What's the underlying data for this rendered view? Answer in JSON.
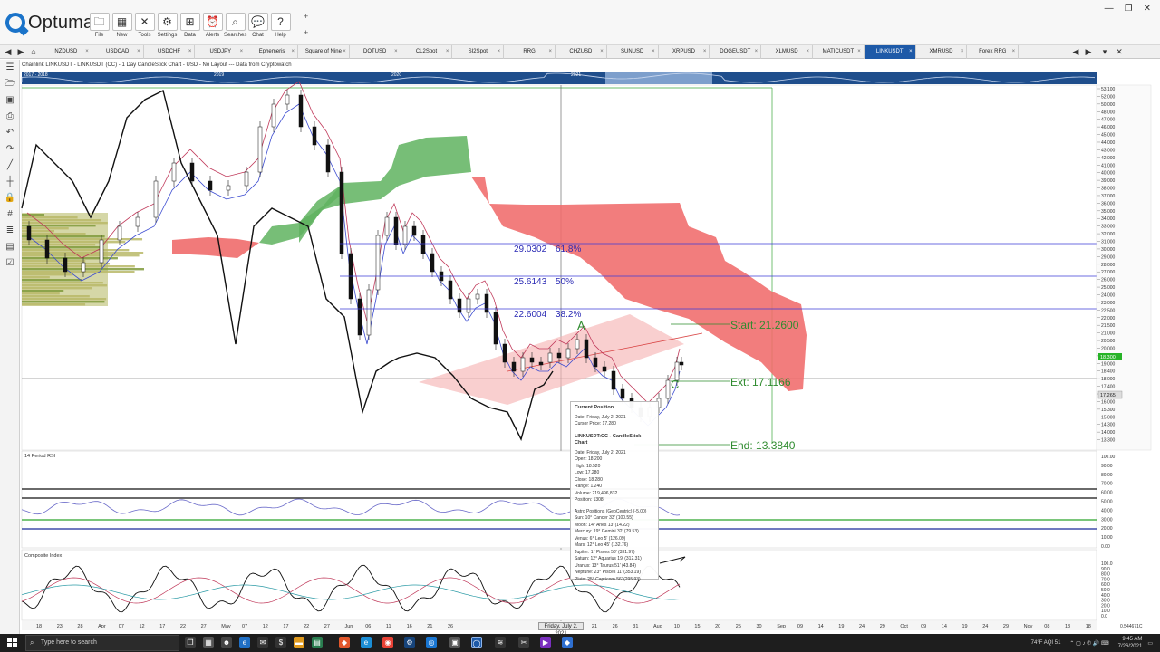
{
  "app": {
    "brand": "Optuma",
    "toolbar": [
      {
        "label": "File",
        "icon": "folder-icon",
        "glyph": "🗀"
      },
      {
        "label": "New",
        "icon": "new-chart-icon",
        "glyph": "▦"
      },
      {
        "label": "Tools",
        "icon": "tools-icon",
        "glyph": "✕"
      },
      {
        "label": "Settings",
        "icon": "gear-icon",
        "glyph": "⚙"
      },
      {
        "label": "Data",
        "icon": "data-icon",
        "glyph": "⊞"
      },
      {
        "label": "Alerts",
        "icon": "alarm-clock-icon",
        "glyph": "⏰"
      },
      {
        "label": "Searches",
        "icon": "search-icon",
        "glyph": "⌕"
      },
      {
        "label": "Chat",
        "icon": "chat-icon",
        "glyph": "💬"
      },
      {
        "label": "Help",
        "icon": "help-icon",
        "glyph": "?"
      }
    ]
  },
  "tabs": [
    {
      "label": "NZDUSD",
      "active": false
    },
    {
      "label": "USDCAD",
      "active": false
    },
    {
      "label": "USDCHF",
      "active": false
    },
    {
      "label": "USDJPY",
      "active": false
    },
    {
      "label": "Ephemeris",
      "active": false
    },
    {
      "label": "Square of Nine",
      "active": false
    },
    {
      "label": "DOTUSD",
      "active": false
    },
    {
      "label": "CL2Spot",
      "active": false
    },
    {
      "label": "SI2Spot",
      "active": false
    },
    {
      "label": "RRG",
      "active": false
    },
    {
      "label": "CHZUSD",
      "active": false
    },
    {
      "label": "SUNUSD",
      "active": false
    },
    {
      "label": "XRPUSD",
      "active": false
    },
    {
      "label": "DOGEUSDT",
      "active": false
    },
    {
      "label": "XLMUSD",
      "active": false
    },
    {
      "label": "MATICUSDT",
      "active": false
    },
    {
      "label": "LINKUSDT",
      "active": true
    },
    {
      "label": "XMRUSD",
      "active": false
    },
    {
      "label": "Forex RRG",
      "active": false
    }
  ],
  "chart": {
    "header": "Chainlink LINKUSDT - LINKUSDT (CC) - 1 Day CandleStick Chart - USD - No Layout --- Data from Cryptowatch",
    "overview_years": [
      "2017 · 2018",
      "2019",
      "2020",
      "2021"
    ],
    "rsi_title": "14 Period RSI",
    "composite_title": "Composite Index",
    "fib_levels": [
      {
        "price": "29.0302",
        "pct": "61.8%"
      },
      {
        "price": "25.6143",
        "pct": "50%"
      },
      {
        "price": "22.6004",
        "pct": "38.2%"
      }
    ],
    "annotations": {
      "start": "Start: 21.2600",
      "ext": "Ext: 17.1166",
      "end": "End: 13.3840",
      "point_a": "A",
      "point_c": "C"
    },
    "current_price": "18.300",
    "cursor_price_tag": "17.265",
    "price_axis": [
      "53.100",
      "52.000",
      "50.000",
      "48.000",
      "47.000",
      "46.000",
      "45.000",
      "44.000",
      "43.000",
      "42.000",
      "41.000",
      "40.000",
      "39.000",
      "38.000",
      "37.000",
      "36.000",
      "35.000",
      "34.000",
      "33.000",
      "32.000",
      "31.000",
      "30.000",
      "29.000",
      "28.000",
      "27.000",
      "26.000",
      "25.000",
      "24.000",
      "23.000",
      "22.500",
      "22.000",
      "21.500",
      "21.000",
      "20.500",
      "20.000",
      "19.400",
      "19.000",
      "18.400",
      "18.000",
      "17.400",
      "17.000",
      "16.000",
      "15.300",
      "15.000",
      "14.300",
      "14.000",
      "13.300"
    ],
    "rsi_axis": [
      "100.00",
      "90.00",
      "80.00",
      "70.00",
      "60.00",
      "50.00",
      "40.00",
      "30.00",
      "20.00",
      "10.00",
      "0.00"
    ],
    "composite_axis": [
      "100.0",
      "90.0",
      "80.0",
      "70.0",
      "60.0",
      "50.0",
      "40.0",
      "30.0",
      "20.0",
      "10.0",
      "0.0"
    ],
    "date_axis": [
      "18",
      "23",
      "28",
      "Apr",
      "07",
      "12",
      "17",
      "22",
      "27",
      "May",
      "07",
      "12",
      "17",
      "22",
      "27",
      "Jun",
      "06",
      "11",
      "16",
      "21",
      "26",
      "",
      "",
      "",
      "",
      "11",
      "16",
      "21",
      "26",
      "31",
      "Aug",
      "10",
      "15",
      "20",
      "25",
      "30",
      "Sep",
      "09",
      "14",
      "19",
      "24",
      "29",
      "Oct",
      "09",
      "14",
      "19",
      "24",
      "29",
      "Nov",
      "08",
      "13",
      "18"
    ],
    "crosshair_date": "Friday, July 2, 2021",
    "axis_scale": "0.544671C",
    "tooltip": {
      "title": "Current Position",
      "date_line": "Date: Friday, July 2, 2021",
      "cursor_line": "Cursor Price: 17.280",
      "section": "LINKUSDT:CC - CandleStick Chart",
      "lines": [
        "Date: Friday, July 2, 2021",
        "Open: 18.200",
        "High: 18.520",
        "Low: 17.280",
        "Close: 18.280",
        "Range: 1.240",
        "Volume: 219,496,832",
        "Position: 1308"
      ],
      "astro_title": "Astro Positions (GeoCentric) (-5.00)",
      "astro": [
        "Sun: 10° Cancer 33' (100.55)",
        "Moon: 14° Aries 13' (14.22)",
        "Mercury: 19° Gemini 32' (79.53)",
        "Venus: 6° Leo 5' (126.09)",
        "Mars: 12° Leo 45' (132.76)",
        "Jupiter: 1° Pisces 58' (331.97)",
        "Saturn: 12° Aquarius 19' (312.31)",
        "Uranus: 13° Taurus 51' (43.84)",
        "Neptune: 23° Pisces 11' (353.19)",
        "Pluto: 25° Capricorn 56' (295.93)"
      ]
    }
  },
  "taskbar": {
    "search_placeholder": "Type here to search",
    "weather": "74°F AQI 51",
    "time": "9:45 AM",
    "date": "7/26/2021"
  },
  "colors": {
    "cloud_green": "#5fb35f",
    "cloud_red": "#f06b6b",
    "fib_line": "#3b3bd9",
    "annotation_green": "#2e8b2e",
    "tab_active": "#1e5aa8"
  }
}
